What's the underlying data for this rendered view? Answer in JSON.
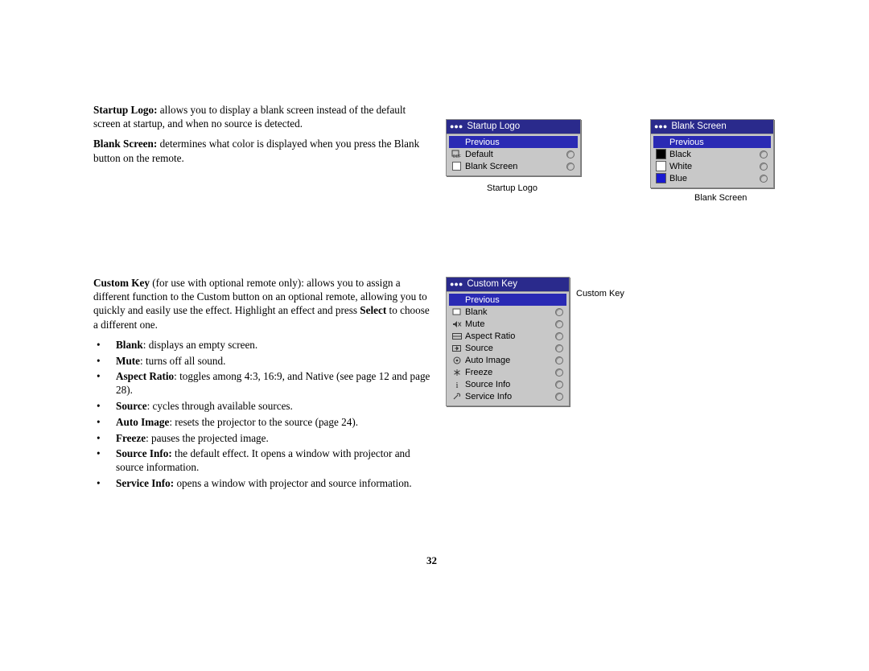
{
  "document": {
    "page_number": "32",
    "paragraphs": [
      {
        "id": "startup-logo",
        "term": "Startup Logo:",
        "text": " allows you to display a blank screen instead of the default screen at startup, and when no source is detected."
      },
      {
        "id": "blank-screen",
        "term": "Blank Screen:",
        "text": " determines what color is displayed when you press the Blank button on the remote."
      }
    ],
    "custom_key_paragraph": {
      "term": "Custom Key",
      "text_1": " (for use with optional remote only): allows you to assign a different function to the Custom button on an optional remote, allowing you to quickly and easily use the effect. Highlight an effect and press ",
      "emphasis": "Select",
      "text_2": " to choose a different one."
    },
    "bullets": [
      {
        "term": "Blank",
        "text": ": displays an empty screen."
      },
      {
        "term": "Mute",
        "text": ": turns off all sound."
      },
      {
        "term": "Aspect Ratio",
        "text": ": toggles among 4:3, 16:9, and Native (see page 12 and page 28)."
      },
      {
        "term": "Source",
        "text": ": cycles through available sources."
      },
      {
        "term": "Auto Image",
        "text": ": resets the projector to the source (page 24)."
      },
      {
        "term": "Freeze",
        "text": ": pauses the projected image."
      },
      {
        "term": "Source Info:",
        "text": " the default effect. It opens a window with projector and source information."
      },
      {
        "term": "Service Info:",
        "text": " opens a window with projector and source information."
      }
    ]
  },
  "menus": {
    "startup_logo": {
      "title": "Startup Logo",
      "title_dots": "●●●",
      "caption": "Startup Logo",
      "rows": [
        {
          "label": "Previous",
          "icon": "none",
          "selected": true,
          "radio": false
        },
        {
          "label": "Default",
          "icon": "default-icon",
          "selected": false,
          "radio": true
        },
        {
          "label": "Blank Screen",
          "icon": "blank-screen-icon",
          "selected": false,
          "radio": true
        }
      ]
    },
    "blank_screen": {
      "title": "Blank Screen",
      "title_dots": "●●●",
      "caption": "Blank Screen",
      "rows": [
        {
          "label": "Previous",
          "icon": "none",
          "selected": true,
          "radio": false
        },
        {
          "label": "Black",
          "icon": "black-swatch-icon",
          "selected": false,
          "radio": true
        },
        {
          "label": "White",
          "icon": "white-swatch-icon",
          "selected": false,
          "radio": true
        },
        {
          "label": "Blue",
          "icon": "blue-swatch-icon",
          "selected": false,
          "radio": true
        }
      ]
    },
    "custom_key": {
      "title": "Custom Key",
      "title_dots": "●●●",
      "caption": "Custom Key",
      "rows": [
        {
          "label": "Previous",
          "icon": "none",
          "selected": true,
          "radio": false
        },
        {
          "label": "Blank",
          "icon": "blank-icon",
          "glyph": "□",
          "selected": false,
          "radio": true
        },
        {
          "label": "Mute",
          "icon": "mute-icon",
          "glyph": "🔇",
          "selected": false,
          "radio": true
        },
        {
          "label": "Aspect Ratio",
          "icon": "aspect-ratio-icon",
          "glyph": "▤",
          "selected": false,
          "radio": true
        },
        {
          "label": "Source",
          "icon": "source-icon",
          "glyph": "⇥",
          "selected": false,
          "radio": true
        },
        {
          "label": "Auto Image",
          "icon": "auto-image-icon",
          "glyph": "◎",
          "selected": false,
          "radio": true
        },
        {
          "label": "Freeze",
          "icon": "freeze-icon",
          "glyph": "✳",
          "selected": false,
          "radio": true
        },
        {
          "label": "Source Info",
          "icon": "source-info-icon",
          "glyph": "i",
          "selected": false,
          "radio": true
        },
        {
          "label": "Service Info",
          "icon": "service-info-icon",
          "glyph": "✇",
          "selected": false,
          "radio": true
        }
      ]
    }
  },
  "colors": {
    "menu_title_bar": "#2a2a8c",
    "menu_selection": "#2a2ab4",
    "menu_background": "#c8c8c8",
    "blue_swatch": "#1a1ad0"
  }
}
